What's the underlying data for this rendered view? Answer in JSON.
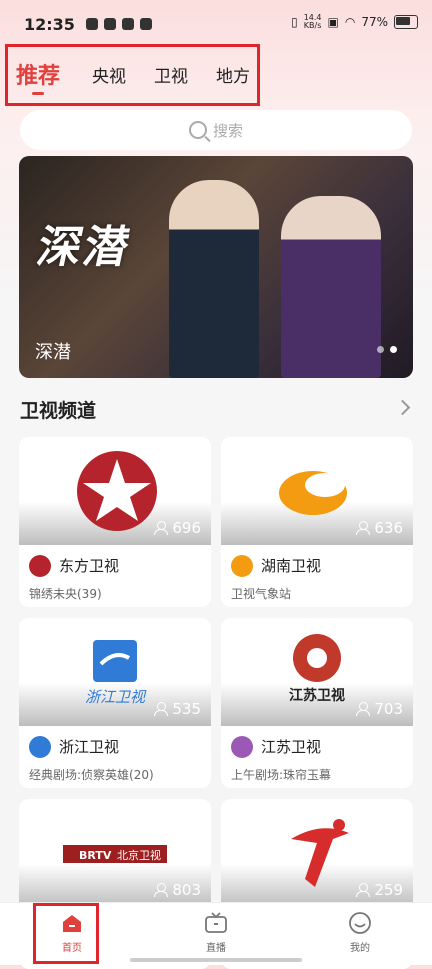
{
  "status_bar": {
    "time": "12:35",
    "net_speed_value": "14.4",
    "net_speed_unit": "KB/s",
    "battery": "77%"
  },
  "top_tabs": [
    {
      "label": "推荐",
      "active": true
    },
    {
      "label": "央视",
      "active": false
    },
    {
      "label": "卫视",
      "active": false
    },
    {
      "label": "地方",
      "active": false
    }
  ],
  "search": {
    "placeholder": "搜索"
  },
  "banner": {
    "title": "深潜",
    "calligraphy": "深潜"
  },
  "section": {
    "title": "卫视频道"
  },
  "channels": [
    {
      "name": "东方卫视",
      "program": "锦绣未央(39)",
      "viewers": "696",
      "color": "#b5242c"
    },
    {
      "name": "湖南卫视",
      "program": "卫视气象站",
      "viewers": "636",
      "color": "#f39c12"
    },
    {
      "name": "浙江卫视",
      "program": "经典剧场:侦察英雄(20)",
      "viewers": "535",
      "color": "#2f7bd6",
      "logo_text": "浙江卫视"
    },
    {
      "name": "江苏卫视",
      "program": "上午剧场:珠帘玉幕",
      "viewers": "703",
      "color": "#9b59b6",
      "logo_text": "江苏卫视"
    },
    {
      "name": "",
      "program": "",
      "viewers": "803",
      "color": "#c0392b",
      "logo_text_a": "BRTV",
      "logo_text_b": "北京卫视"
    },
    {
      "name": "",
      "program": "",
      "viewers": "259",
      "color": "#d62c2c"
    }
  ],
  "bottom_nav": [
    {
      "label": "首页",
      "active": true
    },
    {
      "label": "直播",
      "active": false
    },
    {
      "label": "我的",
      "active": false
    }
  ],
  "accent": "#e0413c"
}
